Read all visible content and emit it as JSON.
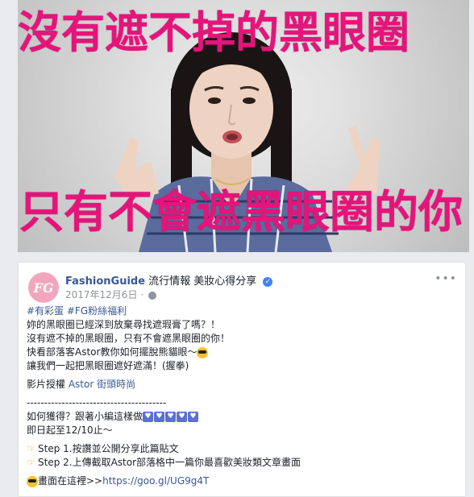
{
  "hero": {
    "caption_top": "沒有遮不掉的黑眼圈",
    "caption_bottom": "只有不會遮黑眼圈的你"
  },
  "post": {
    "avatar_text": "FG",
    "page_name": "FashionGuide",
    "page_subtitle": "流行情報 美妝心得分享",
    "date": "2017年12月6日",
    "more_icon": "more-horizontal-icon",
    "hashtags": "#有彩蛋 #FG粉絲福利",
    "lines": [
      "妳的黑眼圈已經深到放棄尋找遮瑕膏了嗎？！",
      "沒有遮不掉的黑眼圈，只有不會遮黑眼圈的你！",
      "快看部落客Astor教你如何擺脫熊貓眼～",
      "讓我們一起把黑眼圈遮好遮滿！(握拳)"
    ],
    "credit_prefix": "影片授權",
    "credit_link": "Astor 街頭時尚",
    "divider": "----------------------------------------",
    "how_to": "如何獲得？跟著小編這樣做",
    "deadline": "即日起至12/10止～",
    "step1": "Step 1.按讚並公開分享此篇貼文",
    "step2": "Step 2.上傳截取Astor部落格中一篇你最喜歡美妝類文章畫面",
    "screen_prefix": "畫面在這裡>>",
    "screen_link": "https://goo.gl/UG9g4T"
  }
}
